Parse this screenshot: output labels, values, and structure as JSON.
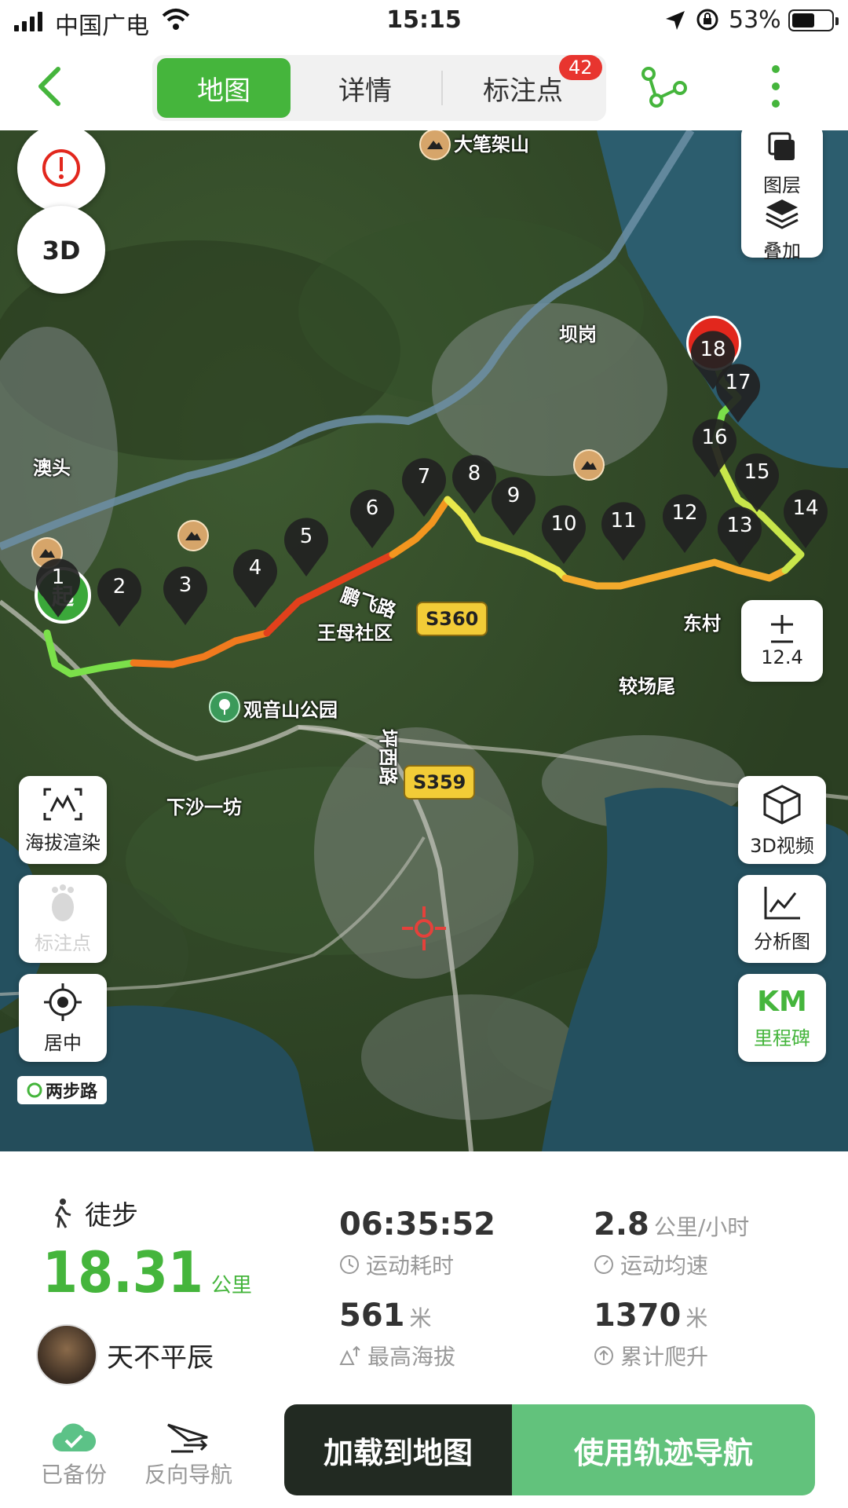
{
  "status_bar": {
    "carrier": "中国广电",
    "time": "15:15",
    "battery_percent": "53%",
    "battery_level": 0.53
  },
  "nav": {
    "tabs": [
      {
        "label": "地图",
        "active": true
      },
      {
        "label": "详情",
        "active": false
      },
      {
        "label": "标注点",
        "active": false
      }
    ],
    "badge_count": "42",
    "icons": {
      "back": "chevron-left-icon",
      "share": "route-share-icon",
      "more": "more-vertical-icon"
    }
  },
  "map": {
    "labels": {
      "mountain_top": "大笔架山",
      "bagang": "坝岗",
      "aotou": "澳头",
      "pengfei_road": "鹏飞路",
      "wangmu": "王母社区",
      "dongcun": "东村",
      "jiaochangwei": "较场尾",
      "guanyinshan": "观音山公园",
      "pingxi_road": "坪西路",
      "xiasha": "下沙一坊"
    },
    "road_badges": {
      "s360": "S360",
      "s359": "S359"
    },
    "waypoints": [
      "1",
      "2",
      "3",
      "4",
      "5",
      "6",
      "7",
      "8",
      "9",
      "10",
      "11",
      "12",
      "13",
      "14",
      "15",
      "16",
      "17",
      "18"
    ],
    "start_label": "起",
    "zoom": "12.4",
    "controls": {
      "alert": "alert-icon",
      "three_d": "3D",
      "layer": "图层",
      "overlay": "叠加",
      "elevation_render": "海拔渲染",
      "marker": "标注点",
      "center": "居中",
      "video_3d": "3D视频",
      "analysis": "分析图",
      "km": "KM",
      "milestone": "里程碑"
    },
    "logo": "两步路"
  },
  "stats": {
    "activity": "徒步",
    "distance": "18.31",
    "distance_unit": "公里",
    "user_name": "天不平辰",
    "duration": "06:35:52",
    "duration_label": "运动耗时",
    "avg_speed": "2.8",
    "avg_speed_unit": "公里/小时",
    "avg_speed_label": "运动均速",
    "max_altitude": "561",
    "max_altitude_unit": "米",
    "max_altitude_label": "最高海拔",
    "total_climb": "1370",
    "total_climb_unit": "米",
    "total_climb_label": "累计爬升"
  },
  "actions": {
    "backed_up": "已备份",
    "reverse_nav": "反向导航",
    "load_to_map": "加载到地图",
    "use_track_nav": "使用轨迹导航"
  },
  "colors": {
    "accent_green": "#45b53c",
    "nav_button": "#62c27c",
    "dark_button": "#222a22",
    "badge_red": "#e8352f"
  }
}
